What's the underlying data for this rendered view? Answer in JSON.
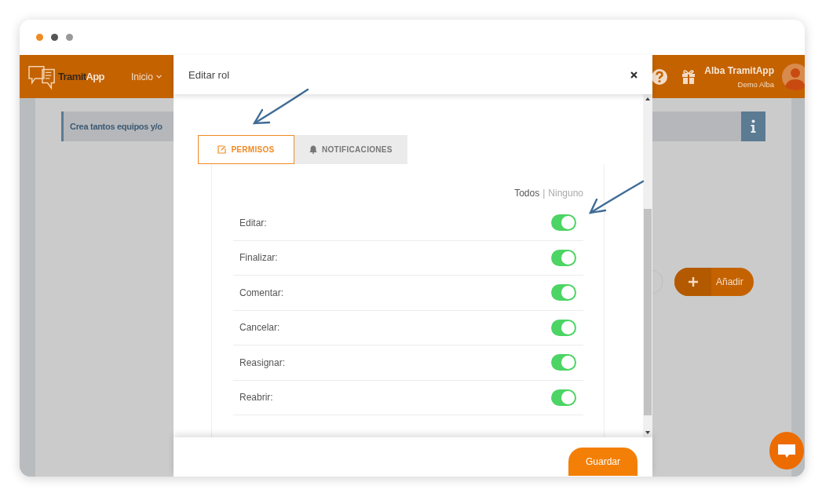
{
  "header": {
    "logo": {
      "part_1": "Tramit",
      "part_2": "App"
    },
    "nav": [
      {
        "label": "Inicio"
      }
    ],
    "user": {
      "name": "Alba TramitApp",
      "subtitle": "Demo Alba"
    }
  },
  "banner": {
    "text": "Crea tantos equipos y/o"
  },
  "add_button": {
    "label": "Añadir"
  },
  "modal": {
    "title": "Editar rol",
    "tabs": [
      {
        "label": "PERMISOS",
        "selected": true
      },
      {
        "label": "NOTIFICACIONES",
        "selected": false
      }
    ],
    "select_all": "Todos",
    "separator": "|",
    "select_none": "Ninguno",
    "permissions": [
      {
        "label": "Editar:",
        "on": true
      },
      {
        "label": "Finalizar:",
        "on": true
      },
      {
        "label": "Comentar:",
        "on": true
      },
      {
        "label": "Cancelar:",
        "on": true
      },
      {
        "label": "Reasignar:",
        "on": true
      },
      {
        "label": "Reabrir:",
        "on": true
      }
    ],
    "save_button": "Guardar"
  }
}
